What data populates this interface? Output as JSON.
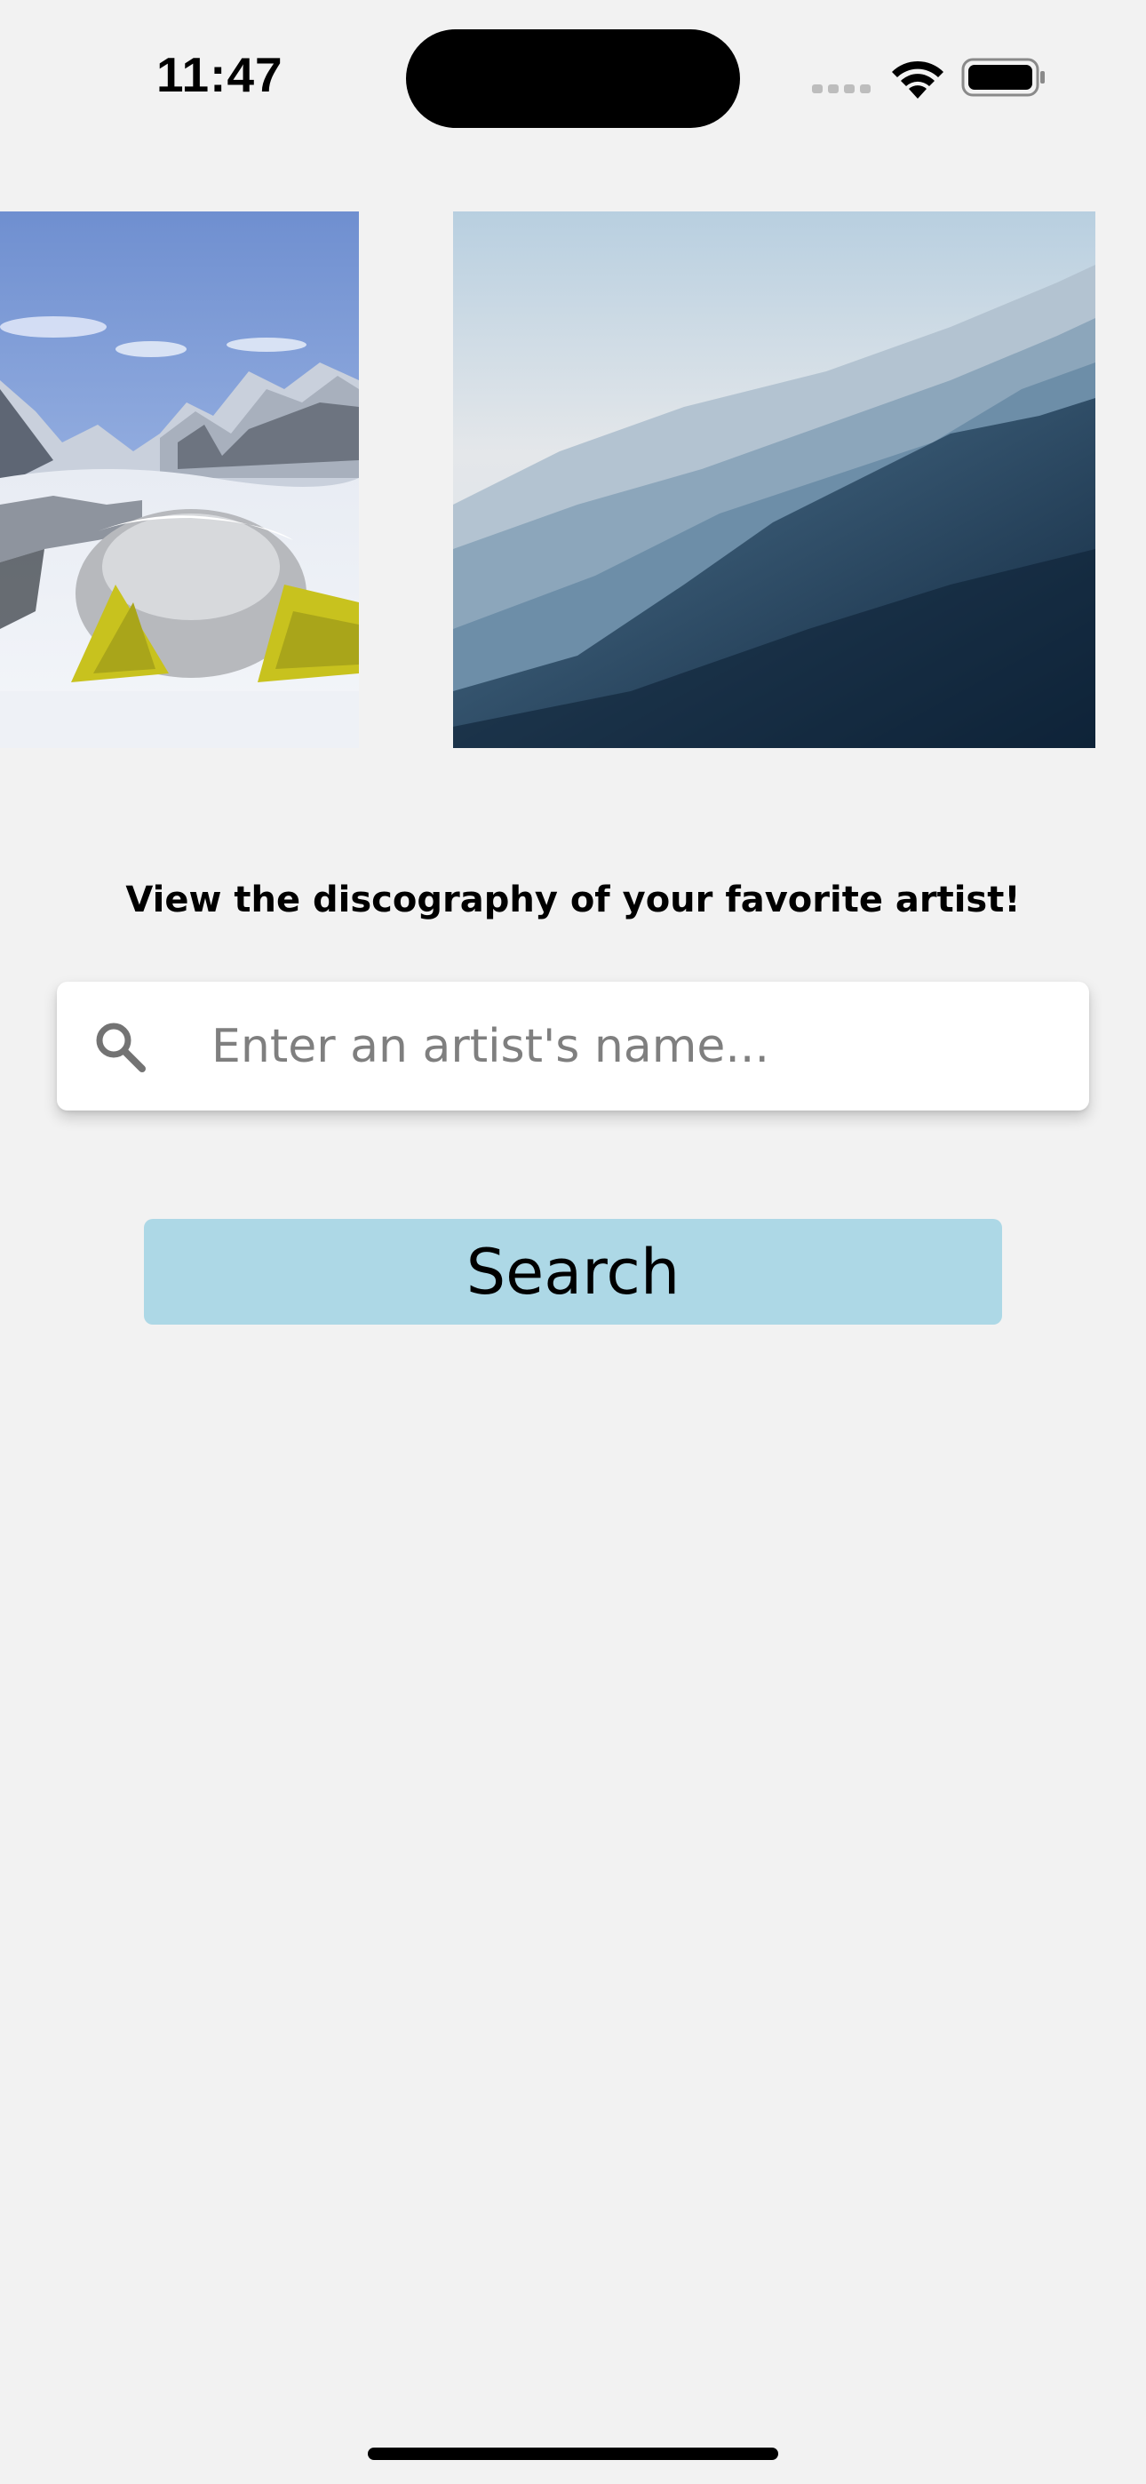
{
  "status_bar": {
    "time": "11:47",
    "icons": [
      "cellular-signal-icon",
      "wifi-icon",
      "battery-icon"
    ]
  },
  "carousel": {
    "images": [
      {
        "name": "snowy-mountain-camp-image"
      },
      {
        "name": "misty-mountain-ridges-image"
      }
    ]
  },
  "main": {
    "tagline": "View the discography of your favorite artist!",
    "search": {
      "placeholder": "Enter an artist's name...",
      "value": "",
      "icon": "search-icon"
    },
    "search_button_label": "Search"
  },
  "colors": {
    "background": "#f2f2f2",
    "button": "#add8e6",
    "input_background": "#ffffff",
    "placeholder": "#7f7f7f"
  }
}
